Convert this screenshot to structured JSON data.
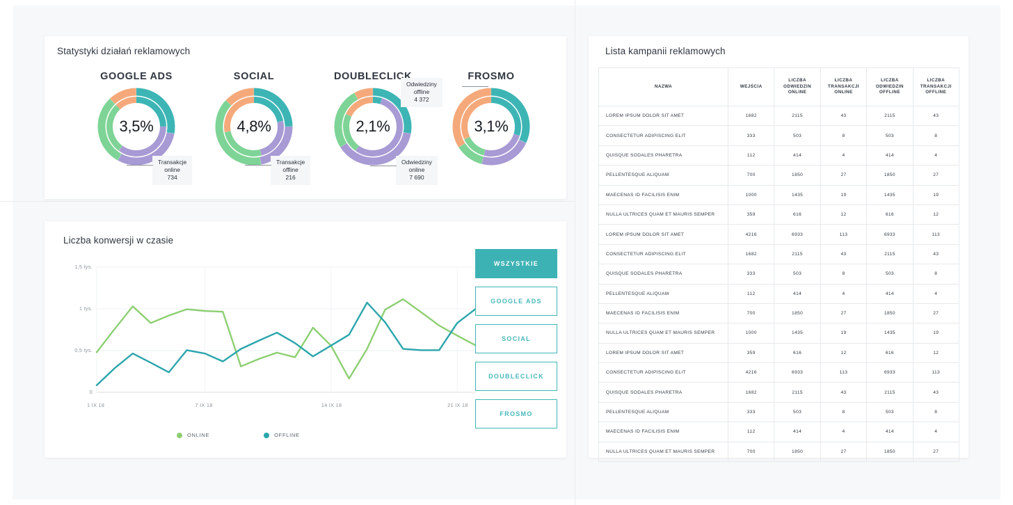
{
  "stats_panel": {
    "title": "Statystyki działań reklamowych",
    "donuts": [
      {
        "label": "GOOGLE ADS",
        "value": "3,5%",
        "segments": [
          {
            "name": "online-visits",
            "color": "#3db5b5",
            "pct": 28
          },
          {
            "name": "online-transactions",
            "color": "#a89ad4",
            "pct": 30
          },
          {
            "name": "offline-visits",
            "color": "#7ed496",
            "pct": 30
          },
          {
            "name": "offline-transactions",
            "color": "#f5a97a",
            "pct": 12
          }
        ],
        "inner_segments": [
          {
            "name": "online-visits",
            "color": "#3db5b5",
            "pct": 25
          },
          {
            "name": "online-transactions",
            "color": "#a89ad4",
            "pct": 35
          },
          {
            "name": "offline-visits",
            "color": "#7ed496",
            "pct": 28
          },
          {
            "name": "offline-transactions",
            "color": "#f5a97a",
            "pct": 12
          }
        ]
      },
      {
        "label": "SOCIAL",
        "value": "4,8%",
        "segments": [
          {
            "name": "online-visits",
            "color": "#3db5b5",
            "pct": 25
          },
          {
            "name": "online-transactions",
            "color": "#a89ad4",
            "pct": 22
          },
          {
            "name": "offline-visits",
            "color": "#7ed496",
            "pct": 40
          },
          {
            "name": "offline-transactions",
            "color": "#f5a97a",
            "pct": 13
          }
        ],
        "inner_segments": [
          {
            "name": "online-visits",
            "color": "#3db5b5",
            "pct": 22
          },
          {
            "name": "online-transactions",
            "color": "#a89ad4",
            "pct": 24
          },
          {
            "name": "offline-visits",
            "color": "#7ed496",
            "pct": 26
          },
          {
            "name": "offline-transactions",
            "color": "#f5a97a",
            "pct": 28
          }
        ]
      },
      {
        "label": "DOUBLECLICK",
        "value": "2,1%",
        "segments": [
          {
            "name": "online-visits",
            "color": "#3db5b5",
            "pct": 28
          },
          {
            "name": "online-transactions",
            "color": "#a89ad4",
            "pct": 38
          },
          {
            "name": "offline-visits",
            "color": "#7ed496",
            "pct": 26
          },
          {
            "name": "offline-transactions",
            "color": "#f5a97a",
            "pct": 8
          }
        ],
        "inner_segments": [
          {
            "name": "online-visits",
            "color": "#3db5b5",
            "pct": 5
          },
          {
            "name": "online-transactions",
            "color": "#a89ad4",
            "pct": 55
          },
          {
            "name": "offline-visits",
            "color": "#7ed496",
            "pct": 22
          },
          {
            "name": "offline-transactions",
            "color": "#f5a97a",
            "pct": 18
          }
        ]
      },
      {
        "label": "FROSMO",
        "value": "3,1%",
        "segments": [
          {
            "name": "online-visits",
            "color": "#3db5b5",
            "pct": 32
          },
          {
            "name": "online-transactions",
            "color": "#a89ad4",
            "pct": 22
          },
          {
            "name": "offline-visits",
            "color": "#7ed496",
            "pct": 12
          },
          {
            "name": "offline-transactions",
            "color": "#f5a97a",
            "pct": 34
          }
        ],
        "inner_segments": [
          {
            "name": "online-visits",
            "color": "#3db5b5",
            "pct": 30
          },
          {
            "name": "online-transactions",
            "color": "#a89ad4",
            "pct": 24
          },
          {
            "name": "offline-visits",
            "color": "#7ed496",
            "pct": 14
          },
          {
            "name": "offline-transactions",
            "color": "#f5a97a",
            "pct": 32
          }
        ]
      }
    ],
    "callouts": [
      {
        "name": "transakcje-online",
        "text": "Transakcje\nonline\n734"
      },
      {
        "name": "transakcje-offline",
        "text": "Transakcje\noffline\n216"
      },
      {
        "name": "odwiedziny-offline",
        "text": "Odwiedziny\noffline\n4 372"
      },
      {
        "name": "odwiedziny-online",
        "text": "Odwiedziny\nonline\n7 690"
      }
    ]
  },
  "line_panel": {
    "title": "Liczba konwersji w czasie",
    "filters": [
      {
        "label": "WSZYSTKIE",
        "active": true
      },
      {
        "label": "GOOGLE ADS",
        "active": false
      },
      {
        "label": "SOCIAL",
        "active": false
      },
      {
        "label": "DOUBLECLICK",
        "active": false
      },
      {
        "label": "FROSMO",
        "active": false
      }
    ]
  },
  "chart_data": {
    "type": "line",
    "title": "Liczba konwersji w czasie",
    "xlabel": "",
    "ylabel": "",
    "ylim": [
      0,
      1500
    ],
    "grid": true,
    "legend_position": "bottom",
    "y_ticks": [
      {
        "value": 1500,
        "label": "1,5 tys."
      },
      {
        "value": 1000,
        "label": "1 tys."
      },
      {
        "value": 500,
        "label": "0,5 tys."
      },
      {
        "value": 0,
        "label": "0"
      }
    ],
    "x_ticks": [
      {
        "index": 0,
        "label": "1 IX 18"
      },
      {
        "index": 6,
        "label": "7 IX 18"
      },
      {
        "index": 13,
        "label": "14 IX 18"
      },
      {
        "index": 20,
        "label": "21 IX 18"
      }
    ],
    "x": [
      "1 IX 18",
      "2 IX 18",
      "3 IX 18",
      "4 IX 18",
      "5 IX 18",
      "6 IX 18",
      "7 IX 18",
      "8 IX 18",
      "9 IX 18",
      "10 IX 18",
      "11 IX 18",
      "12 IX 18",
      "13 IX 18",
      "14 IX 18",
      "15 IX 18",
      "16 IX 18",
      "17 IX 18",
      "18 IX 18",
      "19 IX 18",
      "20 IX 18",
      "21 IX 18",
      "22 IX 18"
    ],
    "series": [
      {
        "name": "ONLINE",
        "color": "#8dcf72",
        "values": [
          480,
          760,
          1030,
          830,
          920,
          995,
          975,
          965,
          310,
          400,
          475,
          420,
          775,
          560,
          165,
          520,
          990,
          1115,
          960,
          800,
          680,
          565
        ]
      },
      {
        "name": "OFFLINE",
        "color": "#2aa5ac",
        "values": [
          85,
          290,
          465,
          355,
          240,
          505,
          465,
          370,
          520,
          620,
          715,
          590,
          430,
          560,
          690,
          1075,
          840,
          520,
          505,
          505,
          830,
          995
        ]
      }
    ],
    "legend": [
      {
        "label": "ONLINE",
        "color": "#8dcf72"
      },
      {
        "label": "OFFLINE",
        "color": "#2aa5ac"
      }
    ]
  },
  "table_panel": {
    "title": "Lista kampanii reklamowych",
    "columns": [
      "NAZWA",
      "WEJŚCIA",
      "LICZBA\nODWIEDZIN\nONLINE",
      "LICZBA\nTRANSAKCJI\nONLINE",
      "LICZBA\nODWIEDZIN\nOFFLINE",
      "LICZBA\nTRANSAKCJI\nOFFLINE"
    ],
    "rows": [
      [
        "LOREM IPSUM DOLOR SIT AMET",
        "1682",
        "2115",
        "43",
        "2115",
        "43"
      ],
      [
        "CONSECTETUR ADIPISCING ELIT",
        "333",
        "503",
        "8",
        "503",
        "8"
      ],
      [
        "QUISQUE SODALES PHARETRA",
        "112",
        "414",
        "4",
        "414",
        "4"
      ],
      [
        "PELLENTESQUE ALIQUAM",
        "700",
        "1850",
        "27",
        "1850",
        "27"
      ],
      [
        "MAECENAS ID FACILISIS ENIM",
        "1000",
        "1435",
        "19",
        "1435",
        "19"
      ],
      [
        "NULLA ULTRICES QUAM ET MAURIS SEMPER",
        "359",
        "616",
        "12",
        "616",
        "12"
      ],
      [
        "LOREM IPSUM DOLOR SIT AMET",
        "4216",
        "6933",
        "113",
        "6933",
        "113"
      ],
      [
        "CONSECTETUR ADIPISCING ELIT",
        "1682",
        "2115",
        "43",
        "2115",
        "43"
      ],
      [
        "QUISQUE SODALES PHARETRA",
        "333",
        "503",
        "8",
        "503",
        "8"
      ],
      [
        "PELLENTESQUE ALIQUAM",
        "112",
        "414",
        "4",
        "414",
        "4"
      ],
      [
        "MAECENAS ID FACILISIS ENIM",
        "700",
        "1850",
        "27",
        "1850",
        "27"
      ],
      [
        "NULLA ULTRICES QUAM ET MAURIS SEMPER",
        "1000",
        "1435",
        "19",
        "1435",
        "19"
      ],
      [
        "LOREM IPSUM DOLOR SIT AMET",
        "359",
        "616",
        "12",
        "616",
        "12"
      ],
      [
        "CONSECTETUR ADIPISCING ELIT",
        "4216",
        "6933",
        "113",
        "6933",
        "113"
      ],
      [
        "QUISQUE SODALES PHARETRA",
        "1682",
        "2115",
        "43",
        "2115",
        "43"
      ],
      [
        "PELLENTESQUE ALIQUAM",
        "333",
        "503",
        "8",
        "503",
        "8"
      ],
      [
        "MAECENAS ID FACILISIS ENIM",
        "112",
        "414",
        "4",
        "414",
        "4"
      ],
      [
        "NULLA ULTRICES QUAM ET MAURIS SEMPER",
        "700",
        "1850",
        "27",
        "1850",
        "27"
      ]
    ]
  }
}
